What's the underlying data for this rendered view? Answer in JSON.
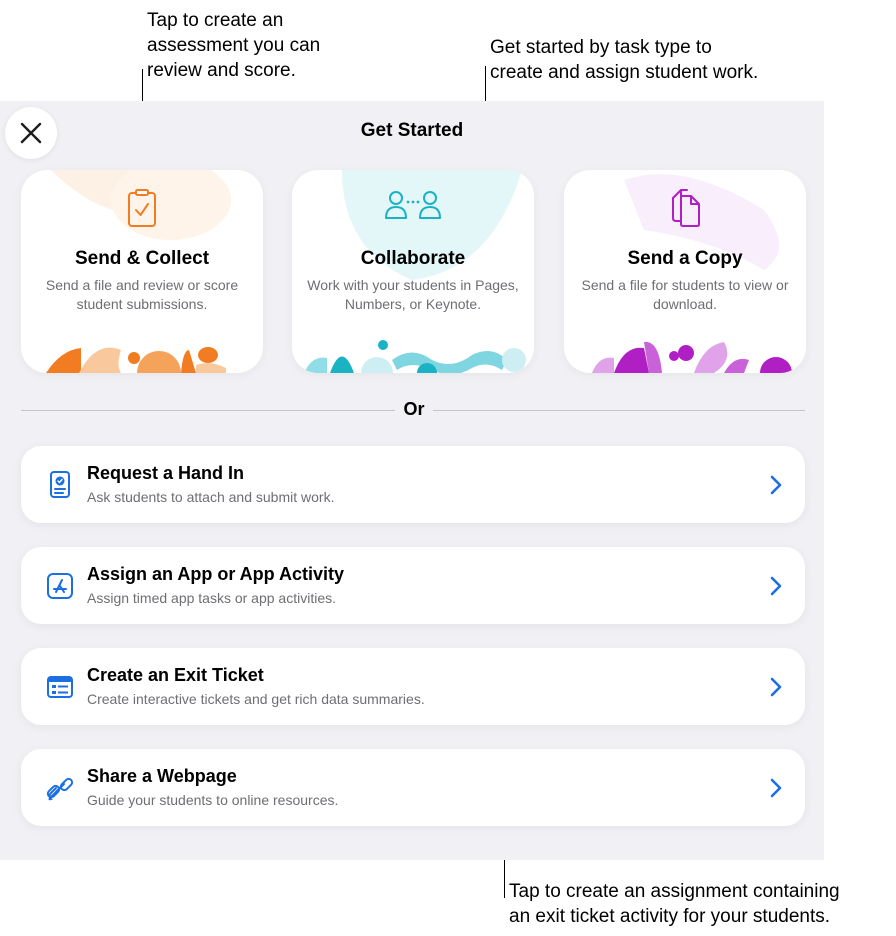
{
  "callouts": {
    "send_collect": "Tap to create an\nassessment you can\nreview and score.",
    "get_started": "Get started by task type to\ncreate and assign student work.",
    "exit_ticket": "Tap to create an assignment containing\nan exit ticket activity for your students."
  },
  "panel": {
    "title": "Get Started",
    "close_icon": "close-icon"
  },
  "cards": [
    {
      "title": "Send & Collect",
      "desc": "Send a file and review or score student submissions.",
      "icon": "checkbox-document-icon",
      "color": "#f27c22"
    },
    {
      "title": "Collaborate",
      "desc": "Work with your students in Pages, Numbers, or Keynote.",
      "icon": "people-icon",
      "color": "#19b3c4"
    },
    {
      "title": "Send a Copy",
      "desc": "Send a file for students to view or download.",
      "icon": "copy-documents-icon",
      "color": "#b01fc4"
    }
  ],
  "divider_label": "Or",
  "rows": [
    {
      "title": "Request a Hand In",
      "subtitle": "Ask students to attach and submit work.",
      "icon": "hand-in-document-icon"
    },
    {
      "title": "Assign an App or App Activity",
      "subtitle": "Assign timed app tasks or app activities.",
      "icon": "app-store-icon"
    },
    {
      "title": "Create an Exit Ticket",
      "subtitle": "Create interactive tickets and get rich data summaries.",
      "icon": "exit-ticket-icon"
    },
    {
      "title": "Share a Webpage",
      "subtitle": "Guide your students to online resources.",
      "icon": "link-icon"
    }
  ],
  "colors": {
    "accent_blue": "#1b6fe3",
    "panel_bg": "#f1f1f5",
    "secondary_text": "#6e6e73"
  }
}
